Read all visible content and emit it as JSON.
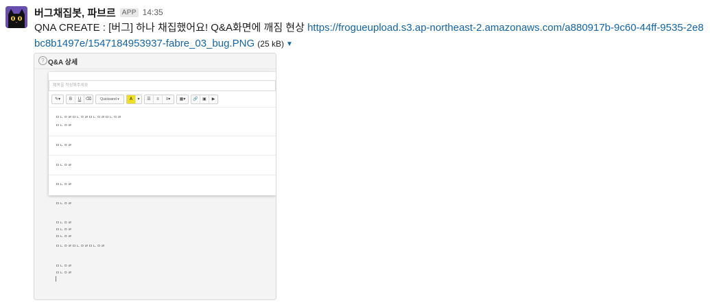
{
  "sender": {
    "name": "버그채집봇, 파브르",
    "badge": "APP",
    "time": "14:35"
  },
  "message": {
    "text": "QNA CREATE : [버그] 하나 채집했어요! Q&A화면에 깨짐 현상",
    "link": "https://frogueupload.s3.ap-northeast-2.amazonaws.com/a880917b-9c60-44ff-9535-2e8bc8b1497e/1547184953937-fabre_03_bug.PNG",
    "filesize": "(25 kB)"
  },
  "preview": {
    "title": "Q&A 상세",
    "title_placeholder": "제목을 작성해주세요",
    "font_name": "Quicksand",
    "toolbar": {
      "pen": "✎▾",
      "bold": "B",
      "underline": "U",
      "eraser": "⌫",
      "font_caret": "▾",
      "color": "A",
      "color_caret": "▾",
      "ul": "☰",
      "ol": "≡",
      "align": "≡▾",
      "table": "▦▾",
      "link": "🔗",
      "image": "▣",
      "video": "▶"
    },
    "lines": [
      "ㅁㄴㅇㄹㅁㄴㅇㄹㅁㄴㅇㄹㅁㄴㅇㄹ",
      "ㅁㄴㅇㄹ",
      "ㅁㄴㅇㄹ",
      "ㅁㄴㅇㄹ",
      "ㅁㄴㅇㄹ",
      "ㅁㄴㅇㄹ",
      "ㅁㄴㅇㄹ",
      "ㅁㄴㅇㄹ",
      "ㅁㄴㅇㄹ",
      "ㅁㄴㅇㄹㅁㄴㅇㄹㅁㄴㅇㄹ",
      "ㅁㄴㅇㄹ",
      "ㅁㄴㅇㄹ"
    ]
  }
}
